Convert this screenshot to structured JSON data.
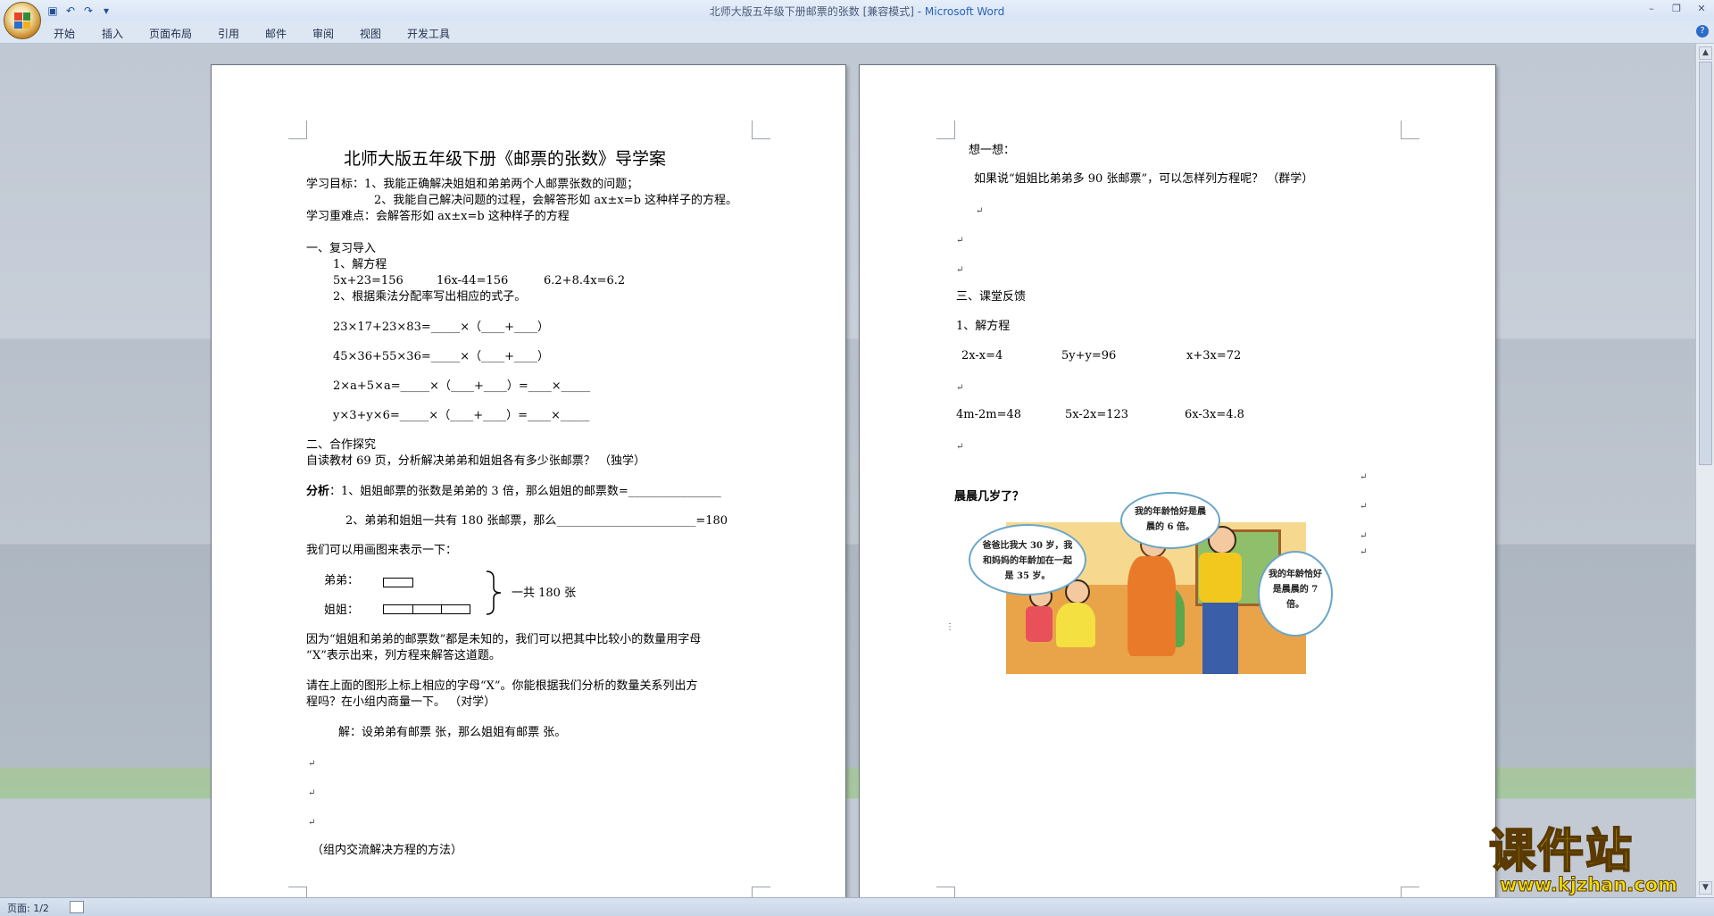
{
  "window": {
    "title_doc": "北师大版五年级下册邮票的张数 [兼容模式] - ",
    "title_app": "Microsoft Word"
  },
  "ribbon": {
    "tabs": [
      "开始",
      "插入",
      "页面布局",
      "引用",
      "邮件",
      "审阅",
      "视图",
      "开发工具"
    ]
  },
  "status": {
    "page": "页面: 1/2"
  },
  "page1": {
    "title": "北师大版五年级下册《邮票的张数》导学案",
    "goal1": "学习目标：1、我能正确解决姐姐和弟弟两个人邮票张数的问题；",
    "goal2": "2、我能自己解决问题的过程，会解答形如 ax±x=b 这种样子的方程。",
    "key": "学习重难点：会解答形如 ax±x=b 这种样子的方程",
    "sec1": "一、复习导入",
    "sec1_1": "1、解方程",
    "eq1": "5x+23=156",
    "eq2": "16x-44=156",
    "eq3": "6.2+8.4x=6.2",
    "sec1_2": "2、根据乘法分配率写出相应的式子。",
    "d1": "23×17+23×83=_____×（____+____）",
    "d2": "45×36+55×36=_____×（____+____）",
    "d3": "2×a+5×a=_____×（____+____）=____×_____",
    "d4": "y×3+y×6=_____×（____+____）=____×_____",
    "sec2": "二、合作探究",
    "read": "自读教材 69 页，分析解决弟弟和姐姐各有多少张邮票？ （独学）",
    "an_label": "分析",
    "an1": "：1、姐姐邮票的张数是弟弟的 3 倍，那么姐姐的邮票数=________________",
    "an2": "2、弟弟和姐姐一共有 180 张邮票，那么________________________=180",
    "draw": "我们可以用画图来表示一下：",
    "brother": "弟弟：",
    "sister": "姐姐：",
    "total": "一共 180 张",
    "p1": "因为“姐姐和弟弟的邮票数”都是未知的，我们可以把其中比较小的数量用字母",
    "p2": "“X”表示出来，列方程来解答这道题。",
    "p3": "请在上面的图形上标上相应的字母“X”。你能根据我们分析的数量关系列出方",
    "p4": "程吗？在小组内商量一下。 （对学）",
    "sol": "解：设弟弟有邮票        张，那么姐姐有邮票         张。",
    "group": "（组内交流解决方程的方法）"
  },
  "page2": {
    "think": "想一想：",
    "q": "如果说“姐姐比弟弟多 90 张邮票”，可以怎样列方程呢？ （群学）",
    "sec3": "三、课堂反馈",
    "s1": "1、解方程",
    "e1": "2x-x=4",
    "e2": "5y+y=96",
    "e3": "x+3x=72",
    "e4": "4m-2m=48",
    "e5": "5x-2x=123",
    "e6": "6x-3x=4.8",
    "age": "晨晨几岁了？",
    "b1": "爸爸比我大 30 岁，我和妈妈的年龄加在一起是 35 岁。",
    "b2": "我的年龄恰好是晨晨的 6 倍。",
    "b3": "我的年龄恰好是晨晨的 7 倍。"
  },
  "watermark": {
    "brand": "课件站",
    "url": "www.kjzhan.com"
  }
}
